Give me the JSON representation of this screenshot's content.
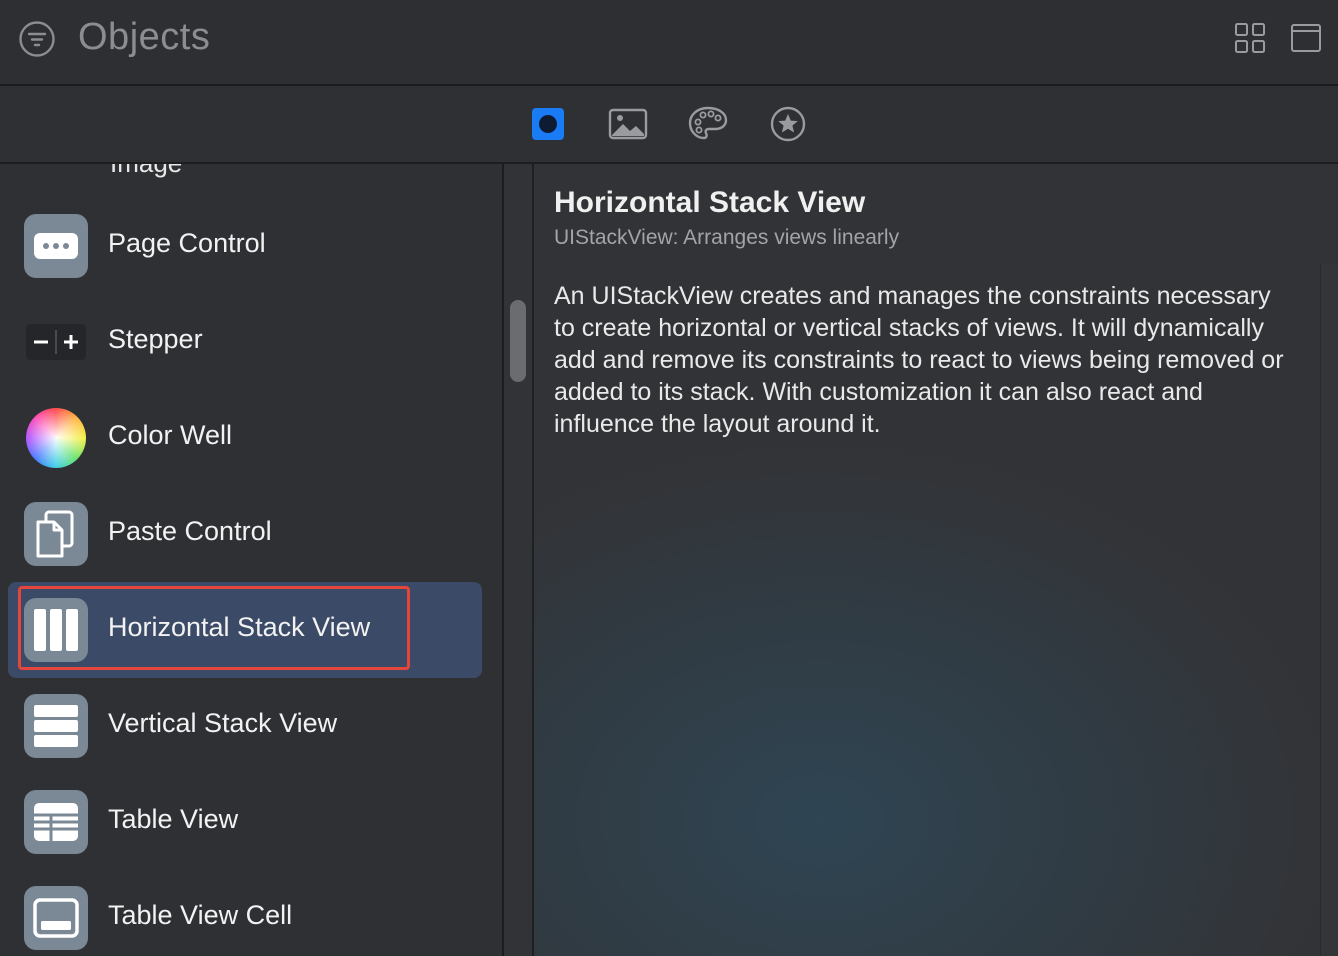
{
  "window": {
    "title": "Objects"
  },
  "toolbar": {
    "tabs": [
      {
        "icon": "square-circle-icon",
        "selected": true
      },
      {
        "icon": "image-icon",
        "selected": false
      },
      {
        "icon": "palette-icon",
        "selected": false
      },
      {
        "icon": "star-circle-icon",
        "selected": false
      }
    ],
    "accent": "#1a7cf5"
  },
  "list": {
    "cut_off_label": "Image",
    "items": [
      {
        "label": "Page Control",
        "icon": "page-control-icon"
      },
      {
        "label": "Stepper",
        "icon": "stepper-icon"
      },
      {
        "label": "Color Well",
        "icon": "color-well-icon"
      },
      {
        "label": "Paste Control",
        "icon": "paste-control-icon"
      },
      {
        "label": "Horizontal Stack View",
        "icon": "horizontal-stack-icon",
        "selected": true
      },
      {
        "label": "Vertical Stack View",
        "icon": "vertical-stack-icon"
      },
      {
        "label": "Table View",
        "icon": "table-view-icon"
      },
      {
        "label": "Table View Cell",
        "icon": "table-view-cell-icon"
      }
    ],
    "selection_color": "#3b4a66",
    "highlight_outline": "#e4463b"
  },
  "detail": {
    "title": "Horizontal Stack View",
    "subtitle": "UIStackView: Arranges views linearly",
    "description": "An UIStackView creates and manages the constraints necessary to create horizontal or vertical stacks of views. It will dynamically add and remove its constraints to react to views being removed or added to its stack. With customization it can also react and influence the layout around it."
  }
}
